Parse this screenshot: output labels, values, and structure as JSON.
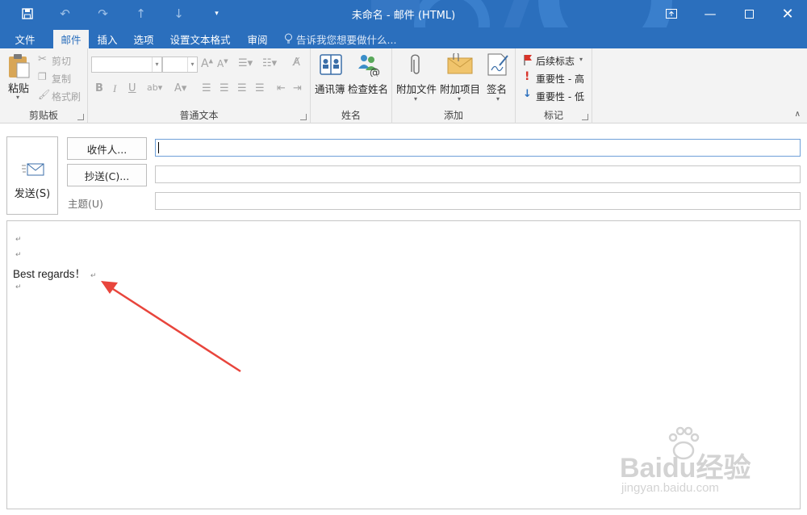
{
  "window": {
    "title": "未命名 - 邮件 (HTML)"
  },
  "tabs": [
    {
      "label": "文件"
    },
    {
      "label": "邮件"
    },
    {
      "label": "插入"
    },
    {
      "label": "选项"
    },
    {
      "label": "设置文本格式"
    },
    {
      "label": "审阅"
    }
  ],
  "tellme": "告诉我您想要做什么...",
  "ribbon": {
    "clipboard": {
      "label": "剪贴板",
      "paste": "粘贴",
      "cut": "剪切",
      "copy": "复制",
      "format_painter": "格式刷"
    },
    "basic_text": {
      "label": "普通文本"
    },
    "names": {
      "label": "姓名",
      "address_book": "通讯簿",
      "check_names": "检查姓名"
    },
    "include": {
      "label": "添加",
      "attach_file": "附加文件",
      "attach_item": "附加项目",
      "signature": "签名"
    },
    "tags": {
      "label": "标记",
      "follow_up": "后续标志",
      "high": "重要性 - 高",
      "low": "重要性 - 低"
    }
  },
  "header": {
    "send": "发送(S)",
    "to": "收件人...",
    "cc": "抄送(C)...",
    "subject": "主题(U)"
  },
  "body": {
    "text": "Best regards！"
  },
  "watermark": {
    "brand": "Baidu经验",
    "url": "jingyan.baidu.com"
  },
  "colors": {
    "accent": "#2b6fbd",
    "arrow": "#e8453c"
  }
}
